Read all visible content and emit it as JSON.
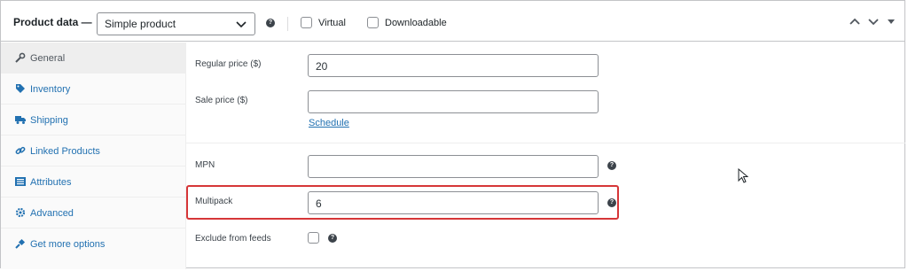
{
  "header": {
    "title": "Product data —",
    "product_type": "Simple product",
    "virtual_label": "Virtual",
    "downloadable_label": "Downloadable"
  },
  "sidebar": {
    "items": [
      {
        "label": "General",
        "icon": "wrench-icon",
        "active": true
      },
      {
        "label": "Inventory",
        "icon": "tag-icon"
      },
      {
        "label": "Shipping",
        "icon": "truck-icon"
      },
      {
        "label": "Linked Products",
        "icon": "link-icon"
      },
      {
        "label": "Attributes",
        "icon": "list-icon"
      },
      {
        "label": "Advanced",
        "icon": "gear-icon"
      },
      {
        "label": "Get more options",
        "icon": "plugin-icon"
      }
    ]
  },
  "fields": {
    "regular_price": {
      "label": "Regular price ($)",
      "value": "20"
    },
    "sale_price": {
      "label": "Sale price ($)",
      "value": ""
    },
    "schedule_link": "Schedule",
    "mpn": {
      "label": "MPN",
      "value": ""
    },
    "multipack": {
      "label": "Multipack",
      "value": "6"
    },
    "exclude_from_feeds": {
      "label": "Exclude from feeds",
      "checked": false
    }
  },
  "colors": {
    "link": "#2271b1",
    "highlight": "#d63638",
    "active_tab_bg": "#eeeeee"
  }
}
